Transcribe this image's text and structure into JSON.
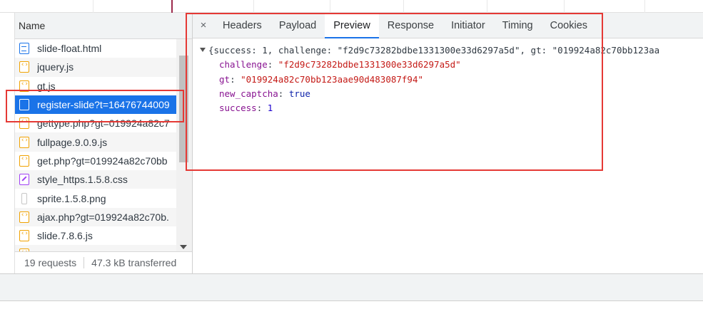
{
  "left_panel": {
    "column_header": "Name",
    "files": [
      {
        "name": "slide-float.html",
        "icon": "document-icon",
        "type": "doc"
      },
      {
        "name": "jquery.js",
        "icon": "script-icon",
        "type": "script"
      },
      {
        "name": "gt.js",
        "icon": "script-icon",
        "type": "script"
      },
      {
        "name": "register-slide?t=16476744009",
        "icon": "document-icon",
        "type": "doc",
        "selected": true
      },
      {
        "name": "gettype.php?gt=019924a82c7",
        "icon": "script-icon",
        "type": "script"
      },
      {
        "name": "fullpage.9.0.9.js",
        "icon": "script-icon",
        "type": "script"
      },
      {
        "name": "get.php?gt=019924a82c70bb",
        "icon": "script-icon",
        "type": "script"
      },
      {
        "name": "style_https.1.5.8.css",
        "icon": "stylesheet-icon",
        "type": "style"
      },
      {
        "name": "sprite.1.5.8.png",
        "icon": "image-icon",
        "type": "image"
      },
      {
        "name": "ajax.php?gt=019924a82c70b.",
        "icon": "script-icon",
        "type": "script"
      },
      {
        "name": "slide.7.8.6.js",
        "icon": "script-icon",
        "type": "script"
      },
      {
        "name": "",
        "icon": "script-icon",
        "type": "script"
      }
    ],
    "status": {
      "requests": "19 requests",
      "transferred": "47.3 kB transferred"
    }
  },
  "right_panel": {
    "close_icon": "×",
    "tabs": [
      "Headers",
      "Payload",
      "Preview",
      "Response",
      "Initiator",
      "Timing",
      "Cookies"
    ],
    "active_tab": "Preview",
    "preview": {
      "summary": "{success: 1, challenge: \"f2d9c73282bdbe1331300e33d6297a5d\", gt: \"019924a82c70bb123aa",
      "fields": [
        {
          "key": "challenge",
          "value": "\"f2d9c73282bdbe1331300e33d6297a5d\"",
          "kind": "string"
        },
        {
          "key": "gt",
          "value": "\"019924a82c70bb123aae90d483087f94\"",
          "kind": "string"
        },
        {
          "key": "new_captcha",
          "value": "true",
          "kind": "keyword"
        },
        {
          "key": "success",
          "value": "1",
          "kind": "number"
        }
      ]
    }
  },
  "colors": {
    "accent": "#1a73e8",
    "annotation": "#e53935",
    "json_key": "#881391",
    "json_string": "#c41a16",
    "json_number": "#1c00cf"
  }
}
